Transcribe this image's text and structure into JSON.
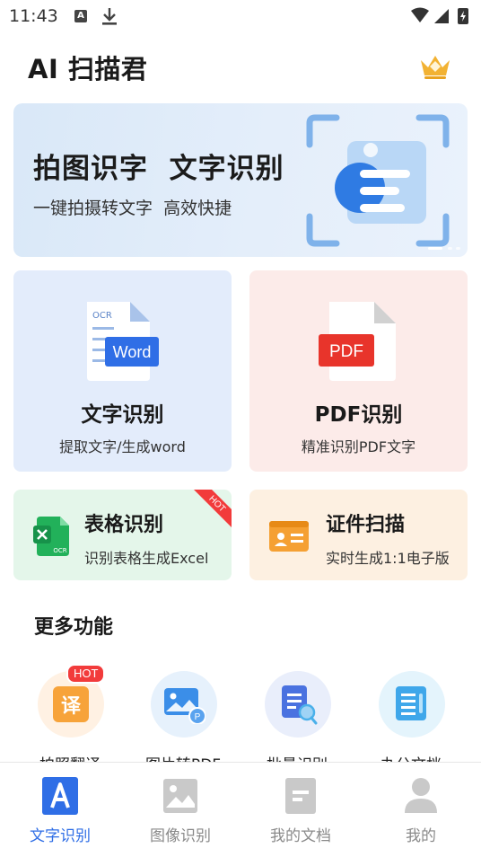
{
  "status_bar": {
    "time": "11:43"
  },
  "app": {
    "title": "AI 扫描君"
  },
  "banner": {
    "title": "拍图识字  文字识别",
    "subtitle": "一键拍摄转文字  高效快捷"
  },
  "features": {
    "ocr": {
      "title": "文字识别",
      "subtitle": "提取文字/生成word",
      "icon_tag": "OCR",
      "icon_badge": "Word"
    },
    "pdf": {
      "title": "PDF识别",
      "subtitle": "精准识别PDF文字",
      "icon_badge": "PDF"
    },
    "table": {
      "title": "表格识别",
      "subtitle": "识别表格生成Excel",
      "ribbon": "HOT",
      "icon_tag": "OCR"
    },
    "id_scan": {
      "title": "证件扫描",
      "subtitle": "实时生成1:1电子版"
    }
  },
  "more": {
    "title": "更多功能",
    "items": [
      {
        "label": "拍照翻译",
        "icon": "translate-icon",
        "badge": "HOT",
        "glyph": "译"
      },
      {
        "label": "图片转PDF",
        "icon": "image-to-pdf-icon"
      },
      {
        "label": "批量识别",
        "icon": "batch-scan-icon"
      },
      {
        "label": "办公文档",
        "icon": "office-doc-icon"
      }
    ]
  },
  "bottom_nav": {
    "items": [
      {
        "label": "文字识别",
        "icon": "text-recognition-icon",
        "active": true
      },
      {
        "label": "图像识别",
        "icon": "image-recognition-icon",
        "active": false
      },
      {
        "label": "我的文档",
        "icon": "my-documents-icon",
        "active": false
      },
      {
        "label": "我的",
        "icon": "profile-icon",
        "active": false
      }
    ]
  },
  "colors": {
    "accent": "#2f6ee6",
    "hot": "#f23b3b",
    "excel_green": "#22b15a",
    "pdf_red": "#e8342b",
    "id_orange": "#f5a033"
  }
}
